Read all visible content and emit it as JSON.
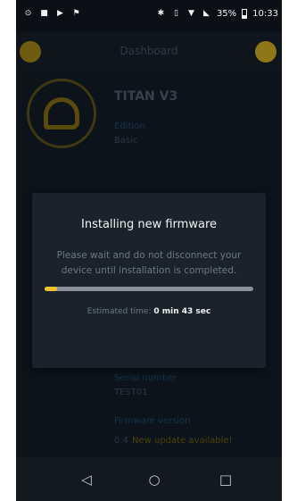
{
  "status_bar": {
    "battery": "35%",
    "time": "10:33",
    "left_icons": [
      "notification-icon",
      "gallery-icon",
      "play-icon",
      "flag-icon"
    ],
    "right_icons": [
      "bluetooth-icon",
      "vibrate-icon",
      "wifi-icon",
      "signal-icon",
      "battery-icon"
    ]
  },
  "app_bar": {
    "title": "Dashboard"
  },
  "device": {
    "name": "TITAN V3",
    "edition_label": "Edition",
    "edition_value": "Basic",
    "serial_label": "Serial number",
    "serial_value": "TEST01",
    "firmware_label": "Firmware version",
    "firmware_value": "0.4",
    "firmware_update": "New update available!"
  },
  "dialog": {
    "title": "Installing new firmware",
    "message": "Please wait and do not disconnect your device until installation is completed.",
    "progress_percent": 6,
    "eta_label": "Estimated time:",
    "eta_value": "0 min 43 sec"
  },
  "colors": {
    "accent": "#f2c12e",
    "dialog_bg": "#1a222c",
    "track": "#8a9099"
  },
  "nav_bar": {
    "back": "◁",
    "home": "○",
    "recent": "□"
  }
}
